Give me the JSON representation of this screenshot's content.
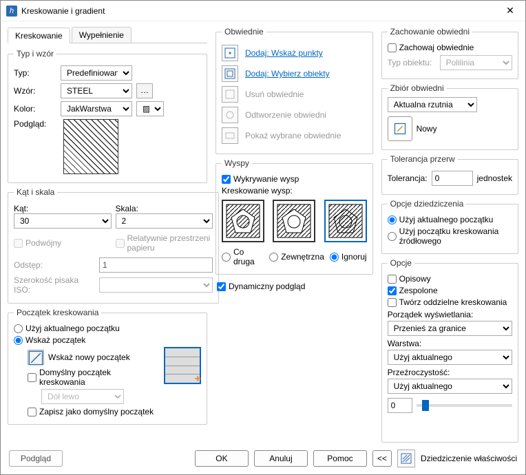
{
  "window": {
    "title": "Kreskowanie i gradient"
  },
  "tabs": {
    "hatch": "Kreskowanie",
    "fill": "Wypełnienie"
  },
  "typeGroup": {
    "legend": "Typ i wzór",
    "typeLabel": "Typ:",
    "typeValue": "Predefiniowana",
    "patternLabel": "Wzór:",
    "patternValue": "STEEL",
    "colorLabel": "Kolor:",
    "colorValue": "JakWarstwa",
    "previewLabel": "Podgląd:"
  },
  "angleGroup": {
    "legend": "Kąt i skala",
    "angleLabel": "Kąt:",
    "angleValue": "30",
    "scaleLabel": "Skala:",
    "scaleValue": "2",
    "doubleLabel": "Podwójny",
    "relPaper": "Relatywnie przestrzeni papieru",
    "spacingLabel": "Odstęp:",
    "spacingValue": "1",
    "isoWidth": "Szerokość pisaka ISO:"
  },
  "originGroup": {
    "legend": "Początek kreskowania",
    "useCurrent": "Użyj aktualnego początku",
    "specify": "Wskaż początek",
    "clickNew": "Wskaż nowy początek",
    "defOrigin": "Domyślny początek kreskowania",
    "bl": "Dół lewo",
    "saveDefault": "Zapisz jako domyślny początek"
  },
  "boundaries": {
    "legend": "Obwiednie",
    "addPick": "Dodaj: Wskaż punkty",
    "addSelect": "Dodaj: Wybierz obiekty",
    "remove": "Usuń obwiednie",
    "recreate": "Odtworzenie obwiedni",
    "show": "Pokaż wybrane obwiednie"
  },
  "islands": {
    "legend": "Wyspy",
    "detect": "Wykrywanie wysp",
    "styleLabel": "Kreskowanie wysp:",
    "optAlt": "Co druga",
    "optOuter": "Zewnętrzna",
    "optIgnore": "Ignoruj"
  },
  "dynamic": "Dynamiczny podgląd",
  "retain": {
    "legend": "Zachowanie obwiedni",
    "retainChk": "Zachowaj obwiednie",
    "objType": "Typ obiektu:",
    "objValue": "Polilinia"
  },
  "bset": {
    "legend": "Zbiór obwiedni",
    "current": "Aktualna rzutnia",
    "new": "Nowy"
  },
  "gap": {
    "legend": "Tolerancja przerw",
    "tolLabel": "Tolerancja:",
    "tolValue": "0",
    "units": "jednostek"
  },
  "inherit": {
    "legend": "Opcje dziedziczenia",
    "useCur": "Użyj aktualnego początku",
    "useSrc": "Użyj początku kreskowania źródłowego"
  },
  "options": {
    "legend": "Opcje",
    "annot": "Opisowy",
    "assoc": "Zespolone",
    "sep": "Twórz oddzielne kreskowania",
    "drawOrderLabel": "Porządek wyświetlania:",
    "drawOrder": "Przenieś za granice",
    "layerLabel": "Warstwa:",
    "layer": "Użyj aktualnego",
    "transLabel": "Przeźroczystość:",
    "trans": "Użyj aktualnego",
    "transVal": "0"
  },
  "footer": {
    "preview": "Podgląd",
    "ok": "OK",
    "cancel": "Anuluj",
    "help": "Pomoc",
    "inheritProps": "Dziedziczenie właściwości"
  }
}
